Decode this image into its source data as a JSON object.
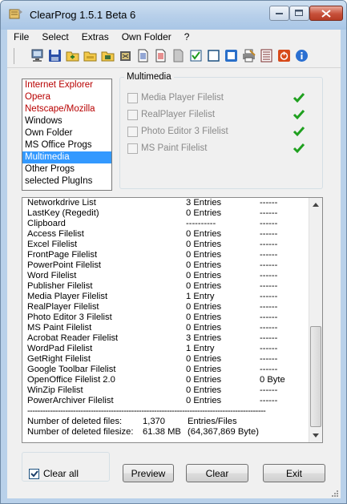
{
  "window": {
    "title": "ClearProg 1.5.1 Beta 6"
  },
  "menu": [
    "File",
    "Select",
    "Extras",
    "Own Folder",
    "?"
  ],
  "toolbar": {
    "buttons": [
      "monitor-icon",
      "save-icon",
      "folder-plus-icon",
      "folder-icon",
      "image-icon",
      "archive-icon",
      "document-icon",
      "document-red-icon",
      "document-gray-icon",
      "checkbox-icon",
      "window-icon",
      "select-all-icon",
      "printer-icon",
      "list-icon",
      "power-icon",
      "info-icon"
    ]
  },
  "categories": [
    {
      "label": "Internet Explorer",
      "color": "red"
    },
    {
      "label": "Opera",
      "color": "red"
    },
    {
      "label": "Netscape/Mozilla",
      "color": "red"
    },
    {
      "label": "Windows",
      "color": "black"
    },
    {
      "label": "Own Folder",
      "color": "black"
    },
    {
      "label": "MS Office Progs",
      "color": "black"
    },
    {
      "label": "Multimedia",
      "color": "selected"
    },
    {
      "label": "Other Progs",
      "color": "black"
    },
    {
      "label": "selected PlugIns",
      "color": "black"
    }
  ],
  "group": {
    "title": "Multimedia",
    "options": [
      {
        "label": "Media Player Filelist",
        "checked": true
      },
      {
        "label": "RealPlayer Filelist",
        "checked": true
      },
      {
        "label": "Photo Editor 3 Filelist",
        "checked": true
      },
      {
        "label": "MS Paint Filelist",
        "checked": true
      }
    ]
  },
  "results": {
    "rows": [
      [
        "Networkdrive List",
        "3 Entries",
        "------"
      ],
      [
        "LastKey (Regedit)",
        "0 Entries",
        "------"
      ],
      [
        "Clipboard",
        "----------",
        "------"
      ],
      [
        "Access Filelist",
        "0 Entries",
        "------"
      ],
      [
        "Excel Filelist",
        "0 Entries",
        "------"
      ],
      [
        "FrontPage Filelist",
        "0 Entries",
        "------"
      ],
      [
        "PowerPoint Filelist",
        "0 Entries",
        "------"
      ],
      [
        "Word Filelist",
        "0 Entries",
        "------"
      ],
      [
        "Publisher Filelist",
        "0 Entries",
        "------"
      ],
      [
        "Media Player Filelist",
        "1 Entry",
        "------"
      ],
      [
        "RealPlayer Filelist",
        "0 Entries",
        "------"
      ],
      [
        "Photo Editor 3 Filelist",
        "0 Entries",
        "------"
      ],
      [
        "MS Paint Filelist",
        "0 Entries",
        "------"
      ],
      [
        "Acrobat Reader Filelist",
        "3 Entries",
        "------"
      ],
      [
        "WordPad Filelist",
        "1 Entry",
        "------"
      ],
      [
        "GetRight Filelist",
        "0 Entries",
        "------"
      ],
      [
        "Google Toolbar Filelist",
        "0 Entries",
        "------"
      ],
      [
        "OpenOffice Filelist 2.0",
        "0 Entries",
        "0 Byte"
      ],
      [
        "WinZip Filelist",
        "0 Entries",
        "------"
      ],
      [
        "PowerArchiver Filelist",
        "0 Entries",
        "------"
      ]
    ],
    "separator": "----------------------------------------------------------------------------------------------",
    "summary": [
      {
        "label": "Number of deleted files:",
        "value": "1,370",
        "extra": "Entries/Files"
      },
      {
        "label": "Number of deleted filesize:",
        "value": "61.38 MB",
        "extra": "(64,367,869 Byte)"
      }
    ]
  },
  "footer": {
    "clear_all_label": "Clear all",
    "clear_all_checked": true,
    "preview_label": "Preview",
    "clear_label": "Clear",
    "exit_label": "Exit"
  }
}
